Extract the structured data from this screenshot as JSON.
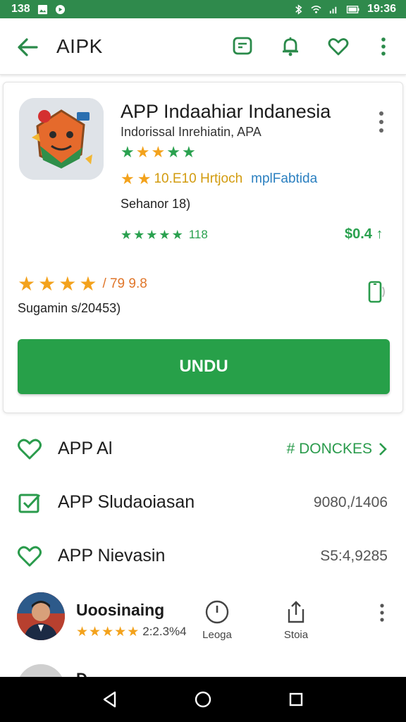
{
  "status_bar": {
    "time_left": "138",
    "time_right": "19:36"
  },
  "app_bar": {
    "title": "AIPK"
  },
  "app": {
    "title": "APP Indaahiar Indanesia",
    "subtitle": "Indorissal Inrehiatin, APA",
    "rating_text": "10.E10 Hrtjoch",
    "rating_text2": "mplFabtida",
    "size_text": "Sehanor 18)",
    "green_count": "118",
    "price": "$0.4 ↑",
    "big_rating_text": "/ 79 9.8",
    "downloads_text": "Sugamin s/20453)",
    "install_label": "UNDU"
  },
  "list": [
    {
      "label": "APP Al",
      "meta": "# DONCKES",
      "icon": "heart-icon"
    },
    {
      "label": "APP Sludaoiasan",
      "meta": "9080,/1406",
      "icon": "checkbox-icon"
    },
    {
      "label": "APP Nievasin",
      "meta": "S5:4,9285",
      "icon": "heart-icon"
    }
  ],
  "review": {
    "name": "Uoosinaing",
    "date": "2:2.3%4",
    "action_1": "Leoga",
    "action_2": "Stoia"
  },
  "peek_name": "D"
}
